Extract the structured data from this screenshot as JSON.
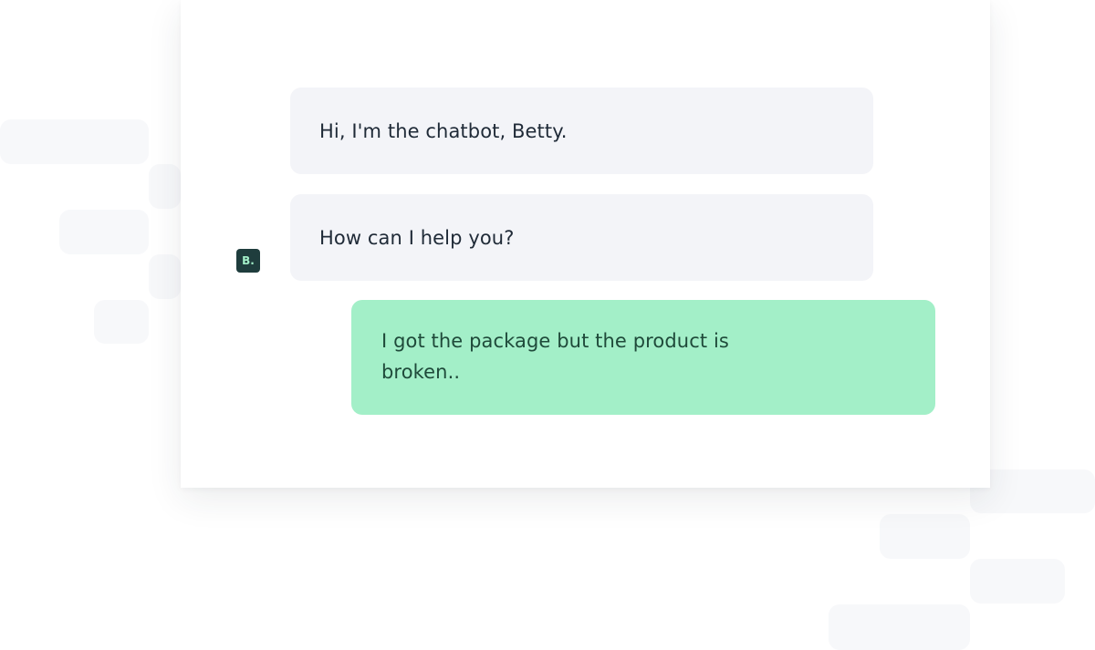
{
  "colors": {
    "background": "#ffffff",
    "card": "#ffffff",
    "bot_bubble": "#f3f4f8",
    "user_bubble": "#a3efc8",
    "avatar_bg": "#1f3d3d",
    "avatar_text": "#a3efc8",
    "bg_tiles": "#f7f8fa"
  },
  "chat": {
    "bot": {
      "avatar_label": "B.",
      "messages": [
        "Hi, I'm the chatbot, Betty.",
        "How can I help you?"
      ]
    },
    "user": {
      "messages": [
        "I got the package but the product is broken.."
      ]
    }
  }
}
